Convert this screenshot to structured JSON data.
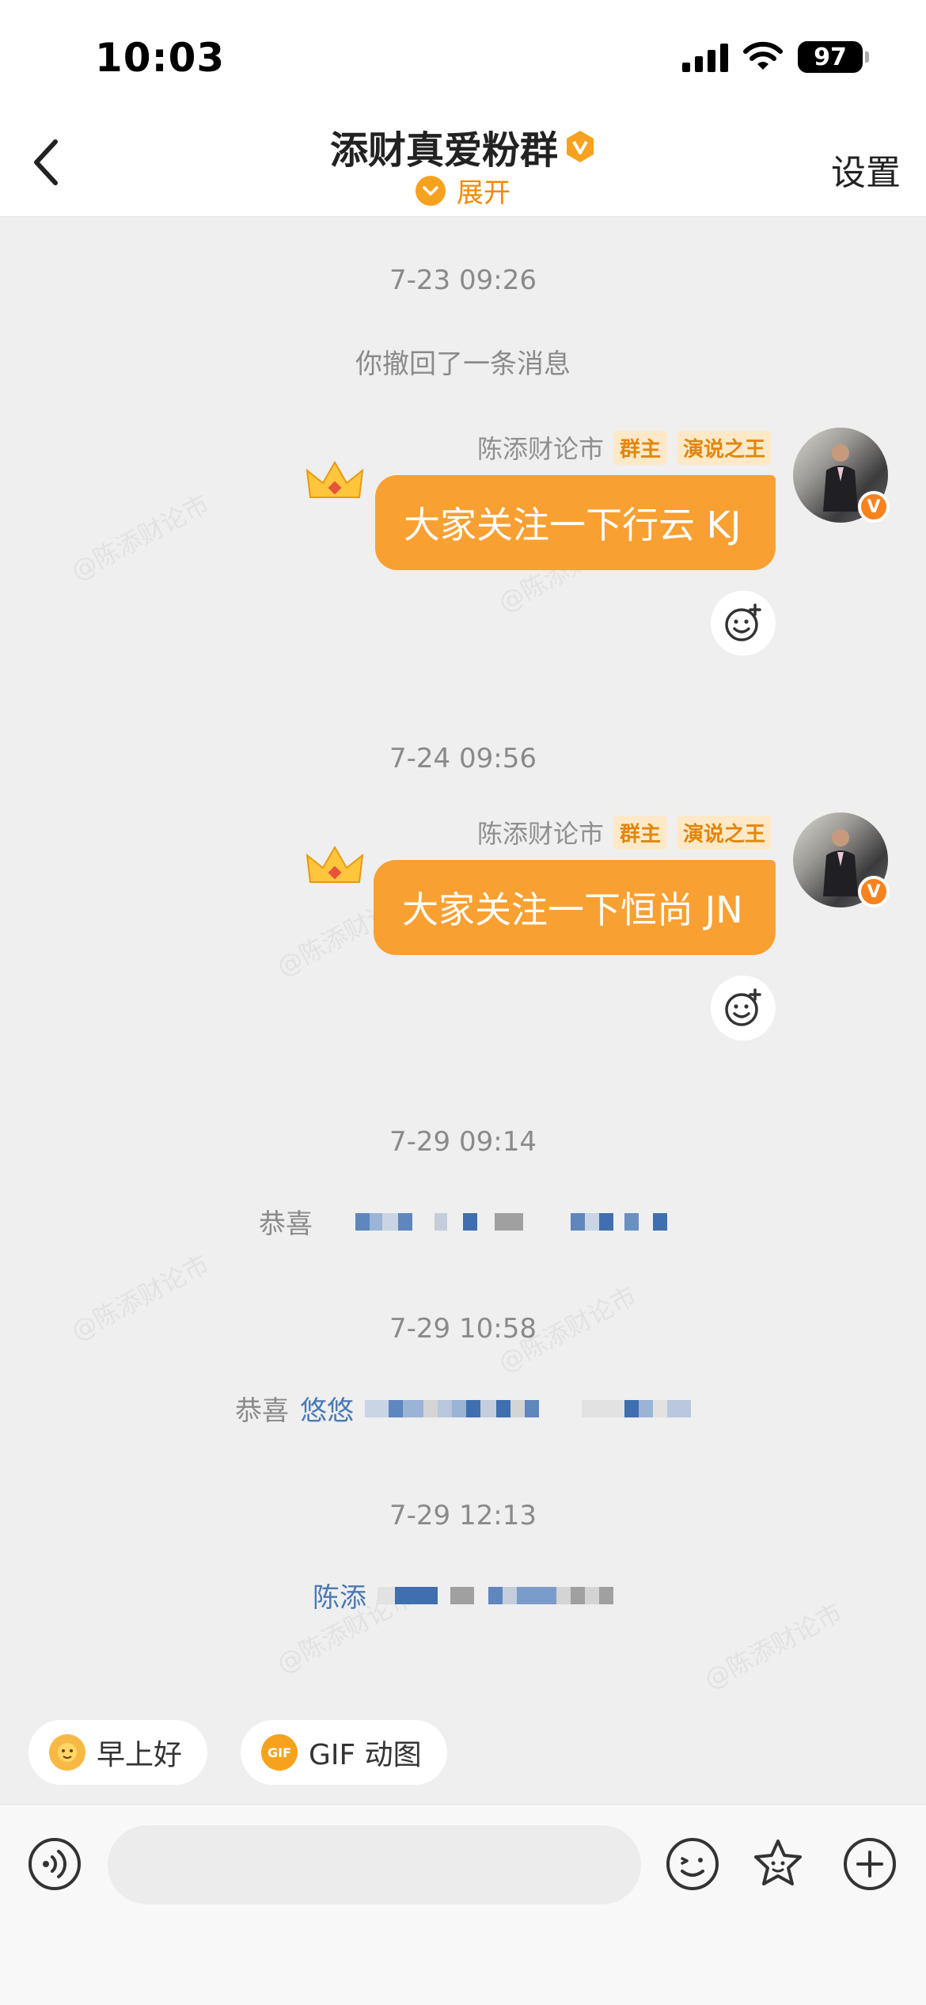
{
  "status": {
    "time": "10:03",
    "battery": "97"
  },
  "header": {
    "title": "添财真爱粉群",
    "expand_label": "展开",
    "settings_label": "设置"
  },
  "watermark_text": "@陈添财论市",
  "messages": [
    {
      "timestamp": "7-23 09:26",
      "system_text": "你撤回了一条消息",
      "sender": "陈添财论市",
      "tags": [
        "群主",
        "演说之王"
      ],
      "text": "大家关注一下行云 KJ"
    },
    {
      "timestamp": "7-24 09:56",
      "sender": "陈添财论市",
      "tags": [
        "群主",
        "演说之王"
      ],
      "text": "大家关注一下恒尚 JN"
    }
  ],
  "notices": [
    {
      "timestamp": "7-29 09:14",
      "prefix": "恭喜",
      "name": ""
    },
    {
      "timestamp": "7-29 10:58",
      "prefix": "恭喜",
      "name": "悠悠"
    },
    {
      "timestamp": "7-29 12:13",
      "prefix": "",
      "name": "陈添"
    }
  ],
  "quick_replies": [
    {
      "label": "早上好",
      "icon": "sun-emoji-icon"
    },
    {
      "label": "GIF 动图",
      "icon": "gif-icon",
      "icon_text": "GIF"
    }
  ],
  "input": {
    "placeholder": ""
  },
  "colors": {
    "accent": "#f9a033",
    "link_blue": "#4a79b5",
    "chat_bg": "#efefef"
  }
}
